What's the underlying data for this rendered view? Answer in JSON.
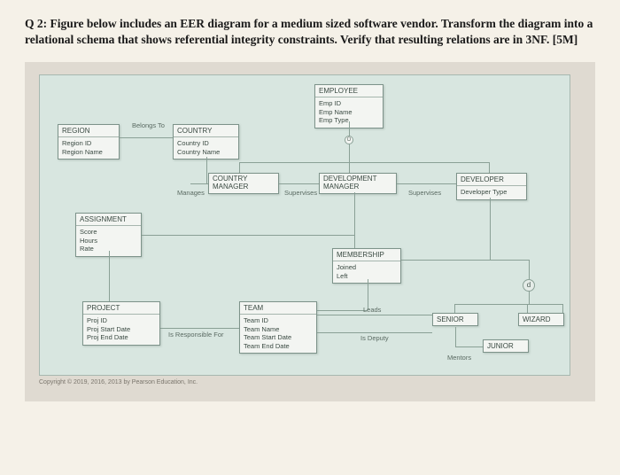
{
  "question": {
    "text": "Q 2: Figure below includes an EER diagram for a medium sized software vendor. Transform the diagram into a relational schema that shows referential integrity constraints. Verify that resulting relations are in 3NF. [5M]"
  },
  "entities": {
    "region": {
      "title": "REGION",
      "attrs": [
        "Region ID",
        "Region Name"
      ]
    },
    "country": {
      "title": "COUNTRY",
      "attrs": [
        "Country ID",
        "Country Name"
      ]
    },
    "employee": {
      "title": "EMPLOYEE",
      "attrs": [
        "Emp ID",
        "Emp Name",
        "Emp Type"
      ]
    },
    "country_manager": {
      "title": "COUNTRY MANAGER",
      "attrs": []
    },
    "development_manager": {
      "title": "DEVELOPMENT MANAGER",
      "attrs": []
    },
    "developer": {
      "title": "DEVELOPER",
      "attrs": [
        "Developer Type"
      ]
    },
    "assignment": {
      "title": "ASSIGNMENT",
      "attrs": [
        "Score",
        "Hours",
        "Rate"
      ]
    },
    "membership": {
      "title": "MEMBERSHIP",
      "attrs": [
        "Joined",
        "Left"
      ]
    },
    "project": {
      "title": "PROJECT",
      "attrs": [
        "Proj ID",
        "Proj Start Date",
        "Proj End Date"
      ]
    },
    "team": {
      "title": "TEAM",
      "attrs": [
        "Team ID",
        "Team Name",
        "Team Start Date",
        "Team End Date"
      ]
    },
    "senior": {
      "title": "SENIOR",
      "attrs": []
    },
    "wizard": {
      "title": "WIZARD",
      "attrs": []
    },
    "junior": {
      "title": "JUNIOR",
      "attrs": []
    }
  },
  "rels": {
    "belongs_to": "Belongs To",
    "manages": "Manages",
    "supervises1": "Supervises",
    "supervises2": "Supervises",
    "is_responsible_for": "Is Responsible For",
    "leads": "Leads",
    "is_deputy": "Is Deputy",
    "mentors": "Mentors"
  },
  "symbols": {
    "o": "O",
    "d": "d"
  },
  "copyright": "Copyright © 2019, 2016, 2013 by Pearson Education, Inc."
}
